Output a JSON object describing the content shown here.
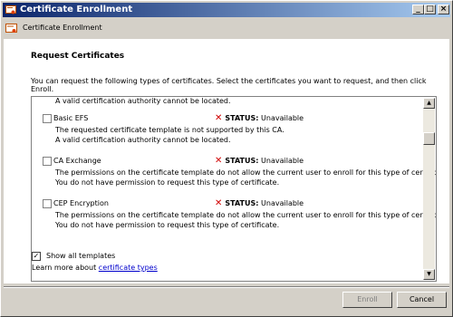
{
  "window": {
    "title": "Certificate Enrollment",
    "controls": {
      "minimize": "_",
      "maximize": "□",
      "close": "×"
    }
  },
  "header": {
    "label": "Certificate Enrollment"
  },
  "main": {
    "title": "Request Certificates",
    "description": "You can request the following types of certificates. Select the certificates you want to request, and then click Enroll."
  },
  "list": {
    "partial_top": "A valid certification authority cannot be located.",
    "status_label": "STATUS:",
    "items": [
      {
        "name": "Basic EFS",
        "status": "Unavailable",
        "desc1": "The requested certificate template is not supported by this CA.",
        "desc2": "A valid certification authority cannot be located."
      },
      {
        "name": "CA Exchange",
        "status": "Unavailable",
        "desc1": "The permissions on the certificate template do not allow the current user to enroll for this type of certificate.",
        "desc2": "You do not have permission to request this type of certificate."
      },
      {
        "name": "CEP Encryption",
        "status": "Unavailable",
        "desc1": "The permissions on the certificate template do not allow the current user to enroll for this type of certificate.",
        "desc2": "You do not have permission to request this type of certificate."
      }
    ]
  },
  "options": {
    "show_all_label": "Show all templates",
    "show_all_checked": true,
    "learn_more_prefix": "Learn more about",
    "learn_more_link": "certificate types"
  },
  "buttons": {
    "enroll": "Enroll",
    "cancel": "Cancel"
  },
  "icons": {
    "status_x": "red-x-icon",
    "app": "certificate-icon",
    "wizard": "certificate-wizard-icon"
  },
  "colors": {
    "title_gradient_start": "#0a246a",
    "title_gradient_end": "#a6caf0",
    "status_x": "#d00000",
    "link": "#0000cc"
  }
}
